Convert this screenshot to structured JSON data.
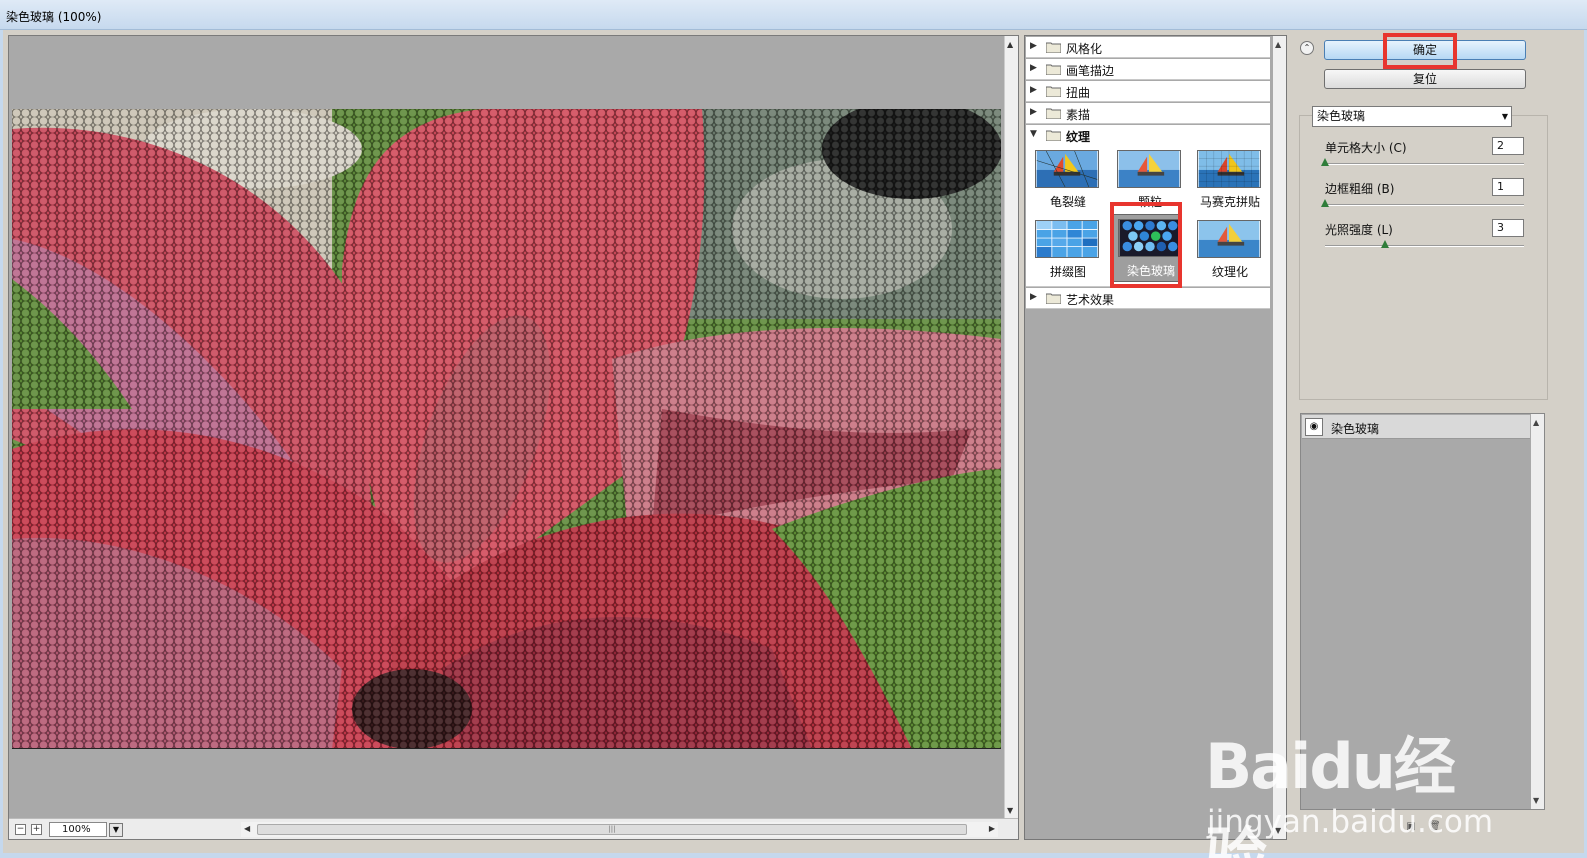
{
  "window": {
    "title": "染色玻璃 (100%)"
  },
  "preview": {
    "zoom": "100%",
    "zoom_minus": "−",
    "zoom_plus": "+"
  },
  "gallery": {
    "categories": [
      {
        "label": "风格化",
        "expanded": false
      },
      {
        "label": "画笔描边",
        "expanded": false
      },
      {
        "label": "扭曲",
        "expanded": false
      },
      {
        "label": "素描",
        "expanded": false
      },
      {
        "label": "纹理",
        "expanded": true
      },
      {
        "label": "艺术效果",
        "expanded": false
      }
    ],
    "thumbnails": [
      {
        "label": "龟裂缝"
      },
      {
        "label": "颗粒"
      },
      {
        "label": "马赛克拼贴"
      },
      {
        "label": "拼缀图"
      },
      {
        "label": "染色玻璃",
        "selected": true
      },
      {
        "label": "纹理化"
      }
    ]
  },
  "panel": {
    "ok_label": "确定",
    "reset_label": "复位",
    "filter_select": "染色玻璃",
    "params": [
      {
        "label": "单元格大小 (C)",
        "value": "2",
        "slider_fraction": 0.0
      },
      {
        "label": "边框粗细 (B)",
        "value": "1",
        "slider_fraction": 0.0
      },
      {
        "label": "光照强度 (L)",
        "value": "3",
        "slider_fraction": 0.3
      }
    ]
  },
  "layers": {
    "items": [
      {
        "label": "染色玻璃"
      }
    ]
  },
  "watermark": {
    "brand": "Baidu经验",
    "url": "jingyan.baidu.com"
  }
}
